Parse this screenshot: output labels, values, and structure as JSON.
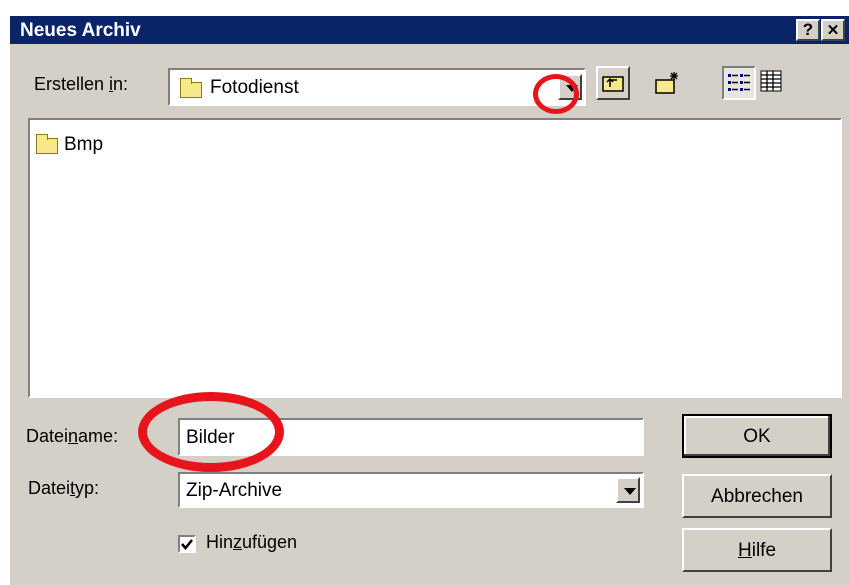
{
  "dialog": {
    "title": "Neues Archiv",
    "help_glyph": "?",
    "close_glyph": "✕"
  },
  "location": {
    "label_pre": "Erstellen ",
    "label_accel": "i",
    "label_post": "n:",
    "value": "Fotodienst"
  },
  "files": [
    {
      "name": "Bmp"
    }
  ],
  "filename": {
    "label_pre": "Datei",
    "label_accel": "n",
    "label_post": "ame:",
    "value": "Bilder"
  },
  "filetype": {
    "label_pre": "Datei",
    "label_accel": "t",
    "label_post": "yp:",
    "value": "Zip-Archive"
  },
  "add_option": {
    "label_pre": "Hin",
    "label_accel": "z",
    "label_post": "ufügen",
    "checked": true
  },
  "buttons": {
    "ok": "OK",
    "cancel": "Abbrechen",
    "help_accel": "H",
    "help_post": "ilfe"
  },
  "icons": {
    "folder": "folder-icon",
    "up": "up-one-level-icon",
    "new_folder": "new-folder-icon",
    "list_view": "list-view-icon",
    "details_view": "details-view-icon"
  },
  "colors": {
    "titlebar": "#0a246a",
    "dialog_face": "#d4d0c8",
    "highlight_circle": "#e8141c",
    "folder": "#f6e98c"
  }
}
